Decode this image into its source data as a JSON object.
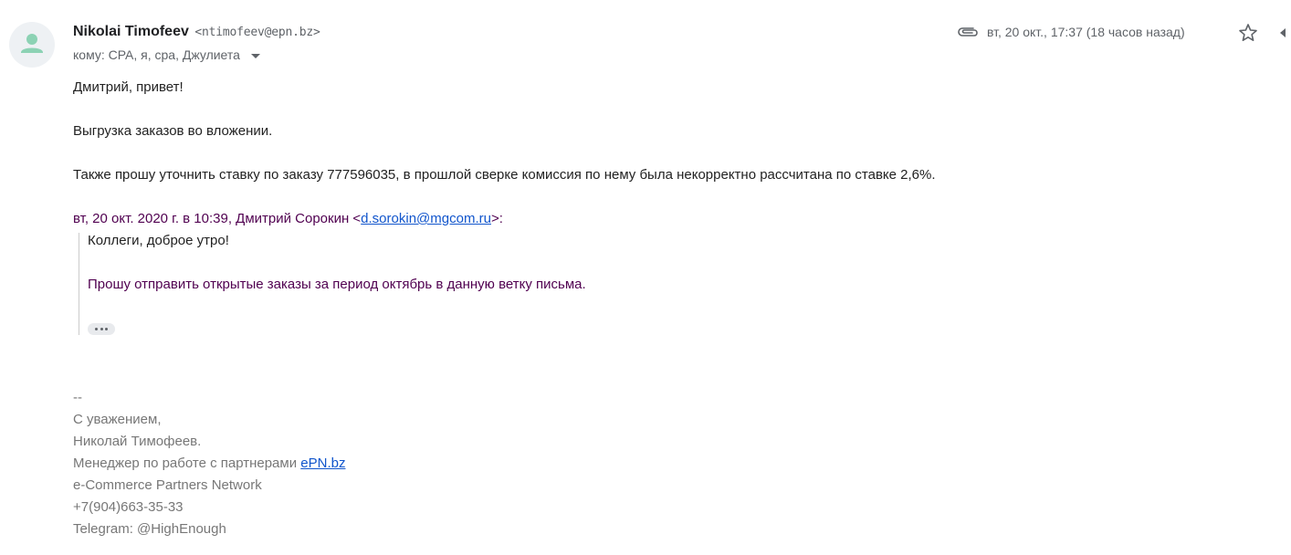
{
  "sender": {
    "name": "Nikolai Timofeev",
    "email": "<ntimofeev@epn.bz>",
    "to_label": "кому: CPA, я, сра, Джулиета"
  },
  "meta": {
    "date": "вт, 20 окт., 17:37 (18 часов назад)"
  },
  "body": {
    "greeting": "Дмитрий, привет!",
    "line1": "Выгрузка заказов во вложении.",
    "line2": "Также прошу уточнить ставку по заказу 777596035, в прошлой сверке комиссия по нему была некорректно рассчитана по ставке 2,6%."
  },
  "quote": {
    "attribution_prefix": "вт, 20 окт. 2020 г. в 10:39, Дмитрий Сорокин <",
    "attribution_email": "d.sorokin@mgcom.ru",
    "attribution_suffix": ">:",
    "line1": "Коллеги, доброе утро!",
    "line2": "Прошу отправить открытые заказы за период октябрь в данную ветку письма."
  },
  "signature": {
    "dashes": "--",
    "regards": "С уважением,",
    "name": "Николай Тимофеев.",
    "position_prefix": "Менеджер по работе с партнерами ",
    "position_link": "ePN.bz",
    "company": "e-Commerce Partners Network",
    "phone": "+7(904)663-35-33",
    "telegram": "Telegram: @HighEnough"
  },
  "icons": {
    "avatar": "person-icon",
    "attachment": "paperclip-icon",
    "star": "star-icon",
    "reply": "reply-icon",
    "expand": "chevron-down-icon",
    "ellipsis": "more-horiz-icon"
  },
  "colors": {
    "link": "#1155cc",
    "quoted": "#500050",
    "avatar_fg": "#8cd2b4",
    "signature": "#777777"
  }
}
